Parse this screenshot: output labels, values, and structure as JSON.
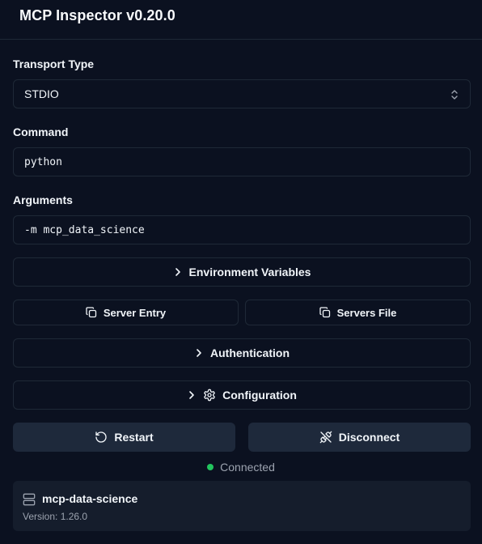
{
  "header": {
    "title": "MCP Inspector v0.20.0"
  },
  "transport": {
    "label": "Transport Type",
    "value": "STDIO"
  },
  "command": {
    "label": "Command",
    "value": "python"
  },
  "arguments": {
    "label": "Arguments",
    "value": "-m mcp_data_science"
  },
  "buttons": {
    "env_vars": "Environment Variables",
    "server_entry": "Server Entry",
    "servers_file": "Servers File",
    "authentication": "Authentication",
    "configuration": "Configuration",
    "restart": "Restart",
    "disconnect": "Disconnect"
  },
  "status": {
    "text": "Connected",
    "color": "#22c55e"
  },
  "server": {
    "name": "mcp-data-science",
    "version": "Version: 1.26.0"
  },
  "icons": {
    "chevron": "chevron-right-icon",
    "copy": "copy-icon",
    "gear": "gear-icon",
    "restart": "rotate-ccw-icon",
    "disconnect": "unplug-icon",
    "server": "server-icon"
  }
}
